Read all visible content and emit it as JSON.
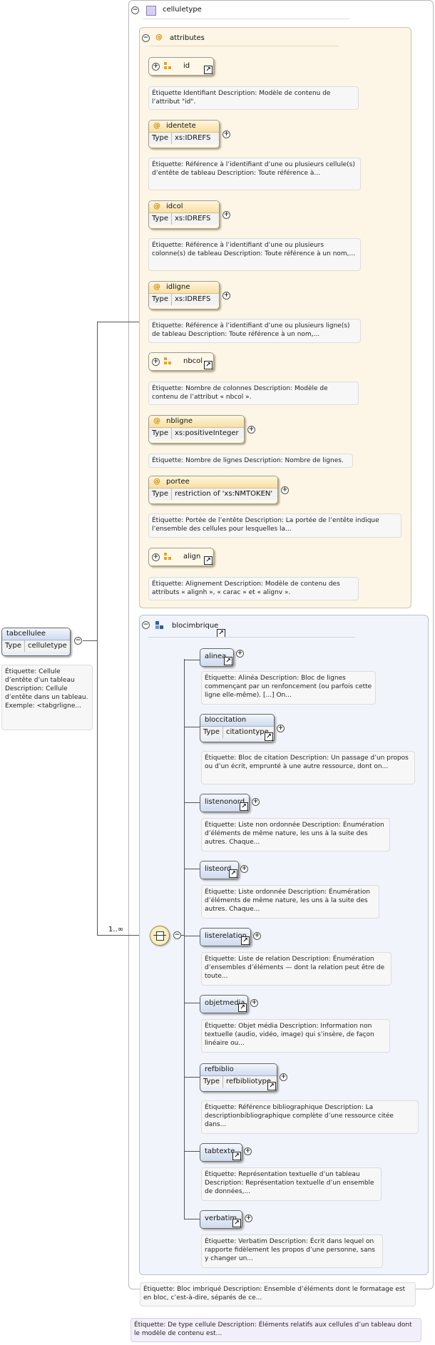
{
  "complex_type": {
    "name": "celluletype"
  },
  "attributes_group": {
    "label": "attributes"
  },
  "attributes": [
    {
      "name": "id",
      "kind": "group",
      "note": "Étiquette Identifiant Description: Modèle de contenu de l’attribut \"id\"."
    },
    {
      "name": "identete",
      "kind": "attribute",
      "type_key": "Type",
      "type_value": "xs:IDREFS",
      "note": "Étiquette: Référence à l’identifiant d’une ou plusieurs cellule(s) d’entête de tableau Description: Toute référence à..."
    },
    {
      "name": "idcol",
      "kind": "attribute",
      "type_key": "Type",
      "type_value": "xs:IDREFS",
      "note": "Étiquette: Référence à l’identifiant d’une ou plusieurs colonne(s) de tableau Description: Toute référence à un nom,..."
    },
    {
      "name": "idligne",
      "kind": "attribute",
      "type_key": "Type",
      "type_value": "xs:IDREFS",
      "note": "Étiquette: Référence à l’identifiant d’une ou plusieurs ligne(s) de tableau Description: Toute référence à un nom,..."
    },
    {
      "name": "nbcol",
      "kind": "group",
      "note": "Étiquette: Nombre de colonnes Description: Modèle de contenu de l’attribut « nbcol »."
    },
    {
      "name": "nbligne",
      "kind": "attribute",
      "type_key": "Type",
      "type_value": "xs:positiveInteger",
      "note": "Étiquette: Nombre de lignes Description: Nombre de lignes."
    },
    {
      "name": "portee",
      "kind": "attribute",
      "type_key": "Type",
      "type_value": "restriction of 'xs:NMTOKEN'",
      "note": "Étiquette: Portée de l’entête Description: La portée de l’entête indique l’ensemble des cellules pour lesquelles la..."
    },
    {
      "name": "align",
      "kind": "group",
      "note": "Étiquette: Alignement Description: Modèle de contenu des attributs « alignh », « carac » et « alignv »."
    }
  ],
  "root_element": {
    "name": "tabcellulee",
    "type_key": "Type",
    "type_value": "celluletype",
    "note": "Étiquette: Cellule d’entête d’un tableau Description: Cellule d’entête dans un tableau. Exemple: <tabgrligne..."
  },
  "choice_group": {
    "name": "blocimbrique",
    "cardinality": "1..∞"
  },
  "choices": [
    {
      "name": "alinea",
      "note": "Étiquette: Alinéa Description: Bloc de lignes commençant par un renfoncement (ou parfois cette ligne elle-même). [...] On..."
    },
    {
      "name": "bloccitation",
      "type_key": "Type",
      "type_value": "citationtype",
      "note": "Étiquette: Bloc de citation Description: Un passage d’un propos ou d’un écrit, emprunté à une autre ressource, dont on..."
    },
    {
      "name": "listenonord",
      "note": "Étiquette: Liste non ordonnée Description: Énumération d’éléments de même nature, les uns à la suite des autres. Chaque..."
    },
    {
      "name": "listeord",
      "note": "Étiquette: Liste ordonnée Description: Énumération d’éléments de même nature, les uns à la suite des autres. Chaque..."
    },
    {
      "name": "listerelation",
      "note": "Étiquette: Liste de relation Description: Énumération d’ensembles d’éléments — dont la relation peut être de toute..."
    },
    {
      "name": "objetmedia",
      "note": "Étiquette: Objet média Description: Information non textuelle (audio, vidéo, image) qui s’insère, de façon linéaire ou..."
    },
    {
      "name": "refbiblio",
      "type_key": "Type",
      "type_value": "refbibliotype",
      "note": "Étiquette: Référence bibliographique Description: La descriptionbibliographique complète d’une ressource citée dans..."
    },
    {
      "name": "tabtexte",
      "note": "Étiquette: Représentation textuelle d’un tableau Description: Représentation textuelle d’un ensemble de données,..."
    },
    {
      "name": "verbatim",
      "note": "Étiquette: Verbatim Description: Écrit dans lequel on rapporte fidèlement les propos d’une personne, sans y changer un..."
    }
  ],
  "choice_group_note": "Étiquette: Bloc imbriqué Description: Ensemble d’éléments dont le formatage est en bloc, c’est-à-dire, séparés de ce...",
  "complex_type_note": "Étiquette: De type cellule Description: Éléments relatifs aux cellules d’un tableau dont le modèle de contenu est...",
  "colors": {
    "element_fill": "#e8eef8",
    "attribute_fill": "#fff8e8",
    "group_icon": "#e8a317",
    "choice_icon": "#2a5ea8"
  }
}
